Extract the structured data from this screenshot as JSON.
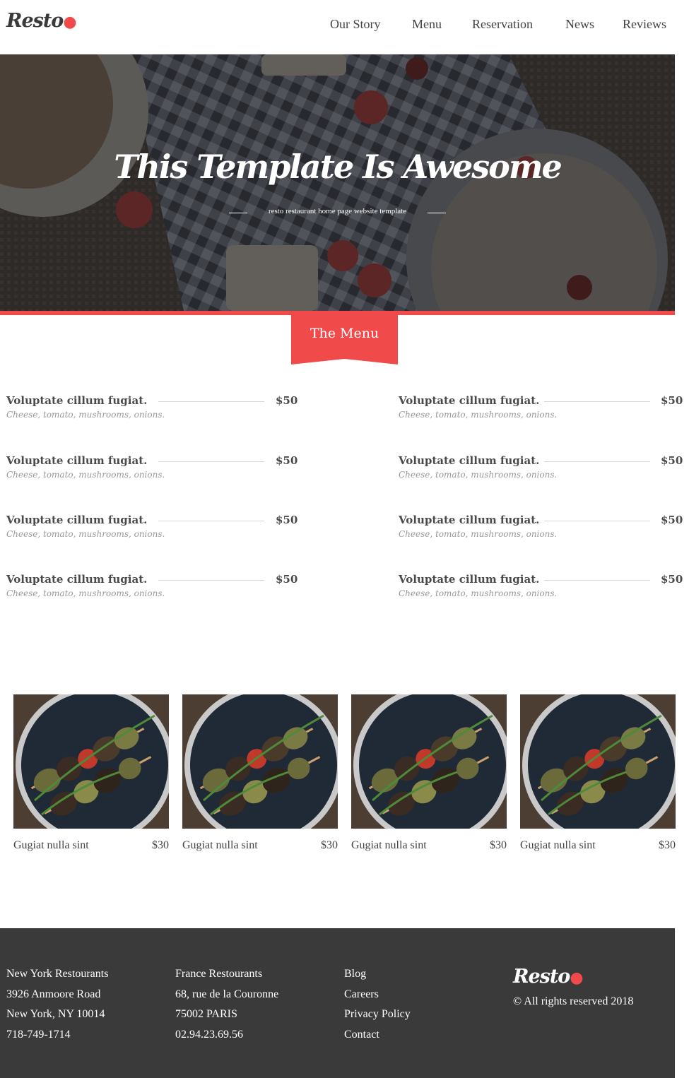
{
  "header": {
    "logo": "Resto",
    "nav": [
      "Our Story",
      "Menu",
      "Reservation",
      "News",
      "Reviews"
    ]
  },
  "hero": {
    "title": "This Template Is Awesome",
    "subtitle": "resto restaurant home page website template"
  },
  "menu_section": {
    "title": "The Menu",
    "items": [
      {
        "name": "Voluptate cillum fugiat.",
        "desc": "Cheese, tomato, mushrooms, onions.",
        "price": "$50"
      },
      {
        "name": "Voluptate cillum fugiat.",
        "desc": "Cheese, tomato, mushrooms, onions.",
        "price": "$50"
      },
      {
        "name": "Voluptate cillum fugiat.",
        "desc": "Cheese, tomato, mushrooms, onions.",
        "price": "$50"
      },
      {
        "name": "Voluptate cillum fugiat.",
        "desc": "Cheese, tomato, mushrooms, onions.",
        "price": "$50"
      },
      {
        "name": "Voluptate cillum fugiat.",
        "desc": "Cheese, tomato, mushrooms, onions.",
        "price": "$50"
      },
      {
        "name": "Voluptate cillum fugiat.",
        "desc": "Cheese, tomato, mushrooms, onions.",
        "price": "$50"
      },
      {
        "name": "Voluptate cillum fugiat.",
        "desc": "Cheese, tomato, mushrooms, onions.",
        "price": "$50"
      },
      {
        "name": "Voluptate cillum fugiat.",
        "desc": "Cheese, tomato, mushrooms, onions.",
        "price": "$50"
      }
    ]
  },
  "dishes": [
    {
      "name": "Gugiat nulla sint",
      "price": "$30"
    },
    {
      "name": "Gugiat nulla sint",
      "price": "$30"
    },
    {
      "name": "Gugiat nulla sint",
      "price": "$30"
    },
    {
      "name": "Gugiat nulla sint",
      "price": "$30"
    }
  ],
  "footer": {
    "columns": [
      [
        "New York Restourants",
        "3926 Anmoore Road",
        "New York, NY 10014",
        "718-749-1714"
      ],
      [
        "France Restourants",
        "68, rue de la Couronne",
        "75002 PARIS",
        "02.94.23.69.56"
      ],
      [
        "Blog",
        "Careers",
        "Privacy Policy",
        "Contact"
      ]
    ],
    "logo": "Resto",
    "copyright": "© All rights reserved 2018"
  },
  "colors": {
    "accent": "#f04a4a",
    "footer_bg": "#3a3a3a",
    "text": "#444444"
  }
}
